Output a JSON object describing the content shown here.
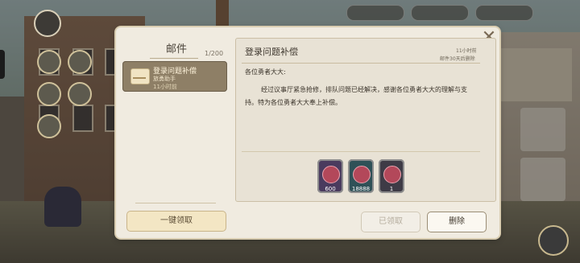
{
  "mail_panel": {
    "title": "邮件",
    "count": "1/200",
    "items": [
      {
        "subject": "登录问题补偿",
        "sender": "旅勇助手",
        "time": "11小时前"
      }
    ],
    "claim_all_label": "一键领取"
  },
  "detail": {
    "title": "登录问题补偿",
    "time": "11小时前",
    "expire": "邮件30天后删除",
    "greeting": "各位勇者大大:",
    "body": "经过议事厅紧急抢修，排队问题已经解决，感谢各位勇者大大的理解与支持。特为各位勇者大大奉上补偿。",
    "attachments": [
      {
        "icon": "gem-icon",
        "quantity": "600"
      },
      {
        "icon": "coin-icon",
        "quantity": "18888"
      },
      {
        "icon": "ticket-icon",
        "quantity": "1"
      }
    ],
    "claimed_label": "已领取",
    "delete_label": "删除"
  },
  "colors": {
    "panel_bg": "#f0ebe0",
    "selected_item": "#8e7f66",
    "accent": "#c9b48a"
  }
}
